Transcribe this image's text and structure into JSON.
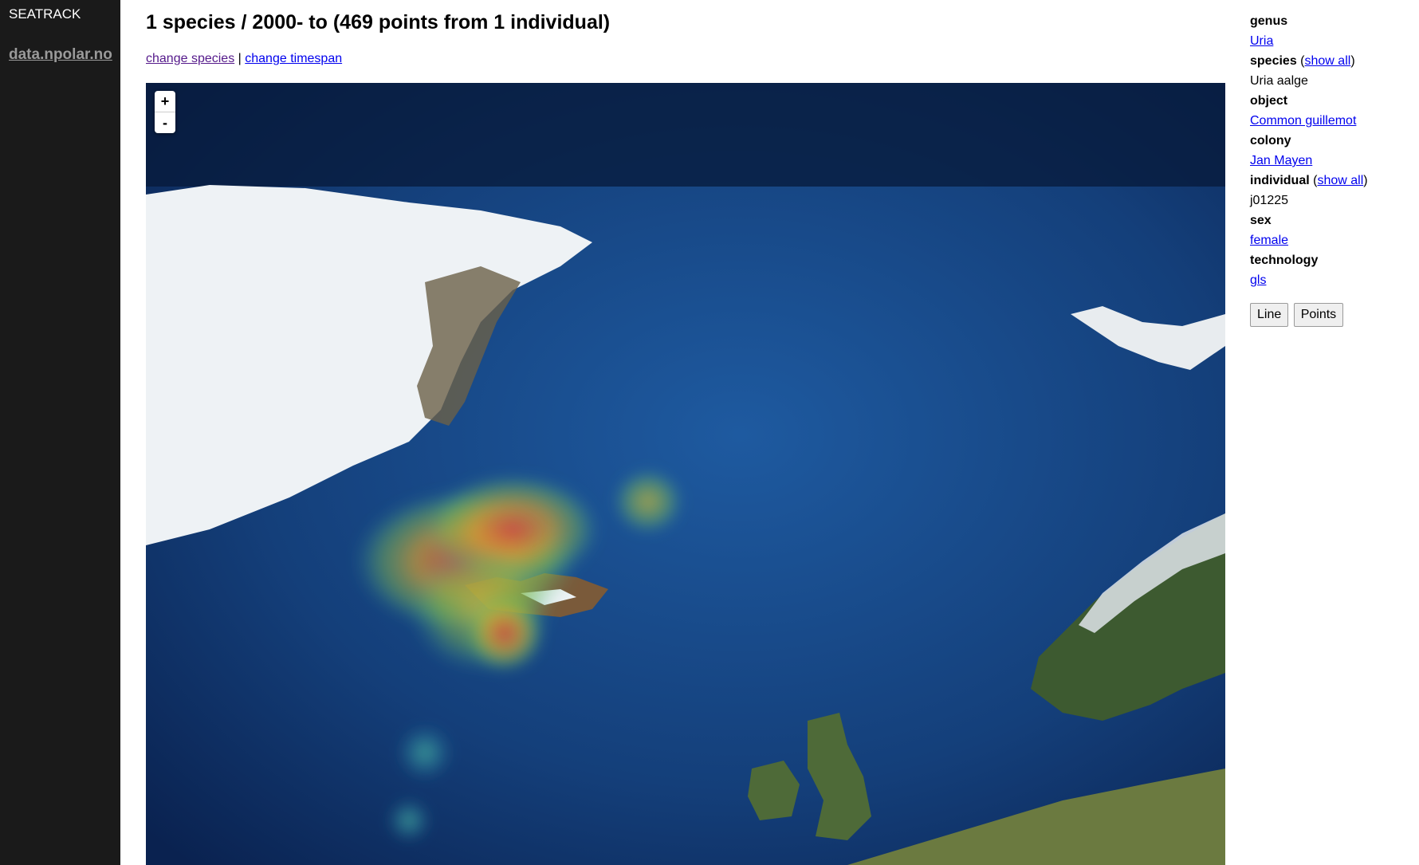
{
  "app": {
    "name": "SEATRACK",
    "brand": "data.npolar.no"
  },
  "page": {
    "title": "1 species / 2000- to (469 points from 1 individual)"
  },
  "nav": {
    "change_species": "change species",
    "separator": "|",
    "change_timespan": "change timespan"
  },
  "map": {
    "zoom_in": "+",
    "zoom_out": "-",
    "layer": "satellite imagery with heatmap overlay"
  },
  "details": {
    "genus_label": "genus",
    "genus_value": "Uria",
    "species_label": "species",
    "species_show_all": "show all",
    "species_value": "Uria aalge",
    "object_label": "object",
    "object_value": "Common guillemot",
    "colony_label": "colony",
    "colony_value": "Jan Mayen",
    "individual_label": "individual",
    "individual_show_all": "show all",
    "individual_value": "j01225",
    "sex_label": "sex",
    "sex_value": "female",
    "technology_label": "technology",
    "technology_value": "gls"
  },
  "buttons": {
    "line": "Line",
    "points": "Points"
  },
  "colors": {
    "sidebar": "#1a1a1a",
    "link": "#0000ee",
    "visited_link": "#551a8b",
    "ocean": "#0d2b5c"
  }
}
